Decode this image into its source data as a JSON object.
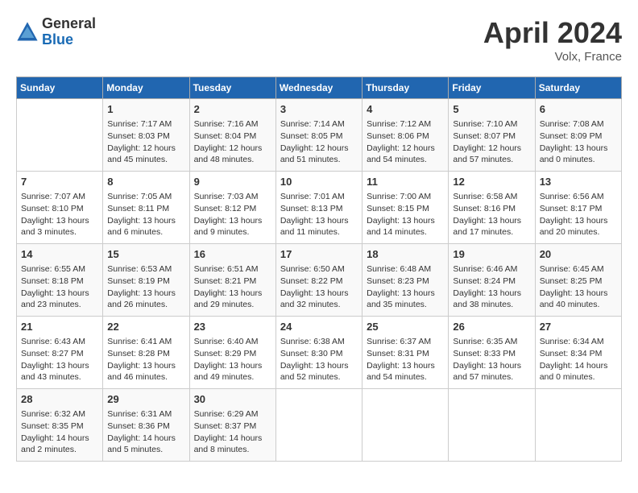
{
  "logo": {
    "general": "General",
    "blue": "Blue"
  },
  "title": "April 2024",
  "location": "Volx, France",
  "days_of_week": [
    "Sunday",
    "Monday",
    "Tuesday",
    "Wednesday",
    "Thursday",
    "Friday",
    "Saturday"
  ],
  "weeks": [
    [
      {
        "day": "",
        "info": ""
      },
      {
        "day": "1",
        "info": "Sunrise: 7:17 AM\nSunset: 8:03 PM\nDaylight: 12 hours\nand 45 minutes."
      },
      {
        "day": "2",
        "info": "Sunrise: 7:16 AM\nSunset: 8:04 PM\nDaylight: 12 hours\nand 48 minutes."
      },
      {
        "day": "3",
        "info": "Sunrise: 7:14 AM\nSunset: 8:05 PM\nDaylight: 12 hours\nand 51 minutes."
      },
      {
        "day": "4",
        "info": "Sunrise: 7:12 AM\nSunset: 8:06 PM\nDaylight: 12 hours\nand 54 minutes."
      },
      {
        "day": "5",
        "info": "Sunrise: 7:10 AM\nSunset: 8:07 PM\nDaylight: 12 hours\nand 57 minutes."
      },
      {
        "day": "6",
        "info": "Sunrise: 7:08 AM\nSunset: 8:09 PM\nDaylight: 13 hours\nand 0 minutes."
      }
    ],
    [
      {
        "day": "7",
        "info": "Sunrise: 7:07 AM\nSunset: 8:10 PM\nDaylight: 13 hours\nand 3 minutes."
      },
      {
        "day": "8",
        "info": "Sunrise: 7:05 AM\nSunset: 8:11 PM\nDaylight: 13 hours\nand 6 minutes."
      },
      {
        "day": "9",
        "info": "Sunrise: 7:03 AM\nSunset: 8:12 PM\nDaylight: 13 hours\nand 9 minutes."
      },
      {
        "day": "10",
        "info": "Sunrise: 7:01 AM\nSunset: 8:13 PM\nDaylight: 13 hours\nand 11 minutes."
      },
      {
        "day": "11",
        "info": "Sunrise: 7:00 AM\nSunset: 8:15 PM\nDaylight: 13 hours\nand 14 minutes."
      },
      {
        "day": "12",
        "info": "Sunrise: 6:58 AM\nSunset: 8:16 PM\nDaylight: 13 hours\nand 17 minutes."
      },
      {
        "day": "13",
        "info": "Sunrise: 6:56 AM\nSunset: 8:17 PM\nDaylight: 13 hours\nand 20 minutes."
      }
    ],
    [
      {
        "day": "14",
        "info": "Sunrise: 6:55 AM\nSunset: 8:18 PM\nDaylight: 13 hours\nand 23 minutes."
      },
      {
        "day": "15",
        "info": "Sunrise: 6:53 AM\nSunset: 8:19 PM\nDaylight: 13 hours\nand 26 minutes."
      },
      {
        "day": "16",
        "info": "Sunrise: 6:51 AM\nSunset: 8:21 PM\nDaylight: 13 hours\nand 29 minutes."
      },
      {
        "day": "17",
        "info": "Sunrise: 6:50 AM\nSunset: 8:22 PM\nDaylight: 13 hours\nand 32 minutes."
      },
      {
        "day": "18",
        "info": "Sunrise: 6:48 AM\nSunset: 8:23 PM\nDaylight: 13 hours\nand 35 minutes."
      },
      {
        "day": "19",
        "info": "Sunrise: 6:46 AM\nSunset: 8:24 PM\nDaylight: 13 hours\nand 38 minutes."
      },
      {
        "day": "20",
        "info": "Sunrise: 6:45 AM\nSunset: 8:25 PM\nDaylight: 13 hours\nand 40 minutes."
      }
    ],
    [
      {
        "day": "21",
        "info": "Sunrise: 6:43 AM\nSunset: 8:27 PM\nDaylight: 13 hours\nand 43 minutes."
      },
      {
        "day": "22",
        "info": "Sunrise: 6:41 AM\nSunset: 8:28 PM\nDaylight: 13 hours\nand 46 minutes."
      },
      {
        "day": "23",
        "info": "Sunrise: 6:40 AM\nSunset: 8:29 PM\nDaylight: 13 hours\nand 49 minutes."
      },
      {
        "day": "24",
        "info": "Sunrise: 6:38 AM\nSunset: 8:30 PM\nDaylight: 13 hours\nand 52 minutes."
      },
      {
        "day": "25",
        "info": "Sunrise: 6:37 AM\nSunset: 8:31 PM\nDaylight: 13 hours\nand 54 minutes."
      },
      {
        "day": "26",
        "info": "Sunrise: 6:35 AM\nSunset: 8:33 PM\nDaylight: 13 hours\nand 57 minutes."
      },
      {
        "day": "27",
        "info": "Sunrise: 6:34 AM\nSunset: 8:34 PM\nDaylight: 14 hours\nand 0 minutes."
      }
    ],
    [
      {
        "day": "28",
        "info": "Sunrise: 6:32 AM\nSunset: 8:35 PM\nDaylight: 14 hours\nand 2 minutes."
      },
      {
        "day": "29",
        "info": "Sunrise: 6:31 AM\nSunset: 8:36 PM\nDaylight: 14 hours\nand 5 minutes."
      },
      {
        "day": "30",
        "info": "Sunrise: 6:29 AM\nSunset: 8:37 PM\nDaylight: 14 hours\nand 8 minutes."
      },
      {
        "day": "",
        "info": ""
      },
      {
        "day": "",
        "info": ""
      },
      {
        "day": "",
        "info": ""
      },
      {
        "day": "",
        "info": ""
      }
    ]
  ]
}
